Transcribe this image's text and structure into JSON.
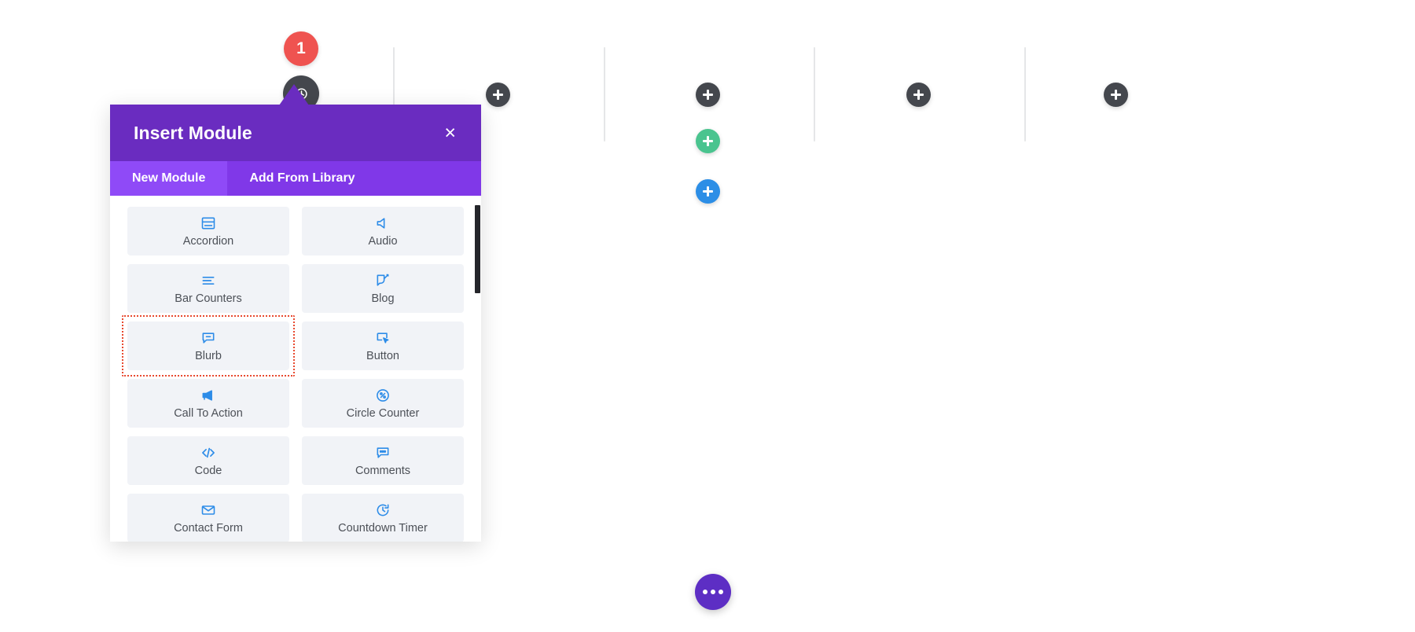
{
  "modal": {
    "title": "Insert Module",
    "close_label": "×",
    "tabs": [
      {
        "label": "New Module",
        "active": true
      },
      {
        "label": "Add From Library",
        "active": false
      }
    ],
    "modules": [
      {
        "label": "Accordion",
        "icon": "accordion-icon",
        "selected": false
      },
      {
        "label": "Audio",
        "icon": "audio-speaker-icon",
        "selected": false
      },
      {
        "label": "Bar Counters",
        "icon": "bar-counters-icon",
        "selected": false
      },
      {
        "label": "Blog",
        "icon": "blog-edit-icon",
        "selected": false
      },
      {
        "label": "Blurb",
        "icon": "blurb-speech-icon",
        "selected": true
      },
      {
        "label": "Button",
        "icon": "button-cursor-icon",
        "selected": false
      },
      {
        "label": "Call To Action",
        "icon": "megaphone-icon",
        "selected": false
      },
      {
        "label": "Circle Counter",
        "icon": "circle-percent-icon",
        "selected": false
      },
      {
        "label": "Code",
        "icon": "code-brackets-icon",
        "selected": false
      },
      {
        "label": "Comments",
        "icon": "comments-icon",
        "selected": false
      },
      {
        "label": "Contact Form",
        "icon": "envelope-icon",
        "selected": false
      },
      {
        "label": "Countdown Timer",
        "icon": "countdown-clock-icon",
        "selected": false
      }
    ]
  },
  "canvas": {
    "row_badge": "1",
    "settings_icon": "clock-icon",
    "fab_icon": "more-dots-icon",
    "add_buttons": [
      {
        "name": "add-module-left",
        "kind": "dark"
      },
      {
        "name": "add-module-center",
        "kind": "dark"
      },
      {
        "name": "add-row-center",
        "kind": "green"
      },
      {
        "name": "add-section-center",
        "kind": "blue"
      },
      {
        "name": "add-module-right",
        "kind": "dark"
      },
      {
        "name": "add-module-far-right",
        "kind": "dark"
      }
    ]
  },
  "colors": {
    "modal_header": "#6a2cc0",
    "modal_tabs": "#8038e8",
    "modal_tab_active": "#8f4af7",
    "badge_red": "#ef5350",
    "dark_btn": "#44474d",
    "green_btn": "#4ac48f",
    "blue_btn": "#2c8ee6",
    "fab_purple": "#5d2ec4",
    "module_icon_blue": "#2d8ce8",
    "module_card_bg": "#f1f3f7",
    "selection_outline": "#e8492f"
  }
}
